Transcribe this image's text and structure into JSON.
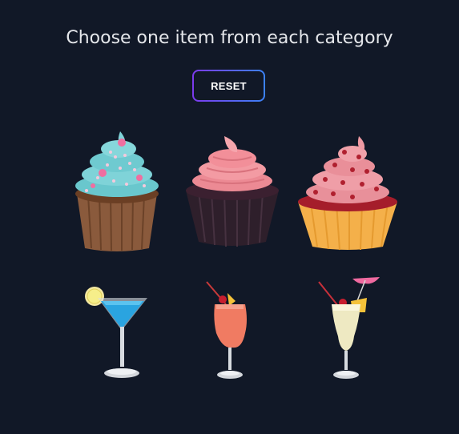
{
  "header": {
    "title": "Choose one item from each category"
  },
  "controls": {
    "reset_label": "RESET"
  },
  "categories": [
    {
      "items": [
        {
          "icon": "blue-frosting-cupcake-icon"
        },
        {
          "icon": "pink-frosting-cupcake-icon"
        },
        {
          "icon": "red-velvet-cupcake-icon"
        }
      ]
    },
    {
      "items": [
        {
          "icon": "blue-martini-cocktail-icon"
        },
        {
          "icon": "orange-hurricane-cocktail-icon"
        },
        {
          "icon": "pina-colada-cocktail-icon"
        }
      ]
    }
  ],
  "colors": {
    "background": "#111827",
    "title_text": "#e5e7eb",
    "button_gradient_start": "#7c3aed",
    "button_gradient_end": "#3b82f6"
  }
}
